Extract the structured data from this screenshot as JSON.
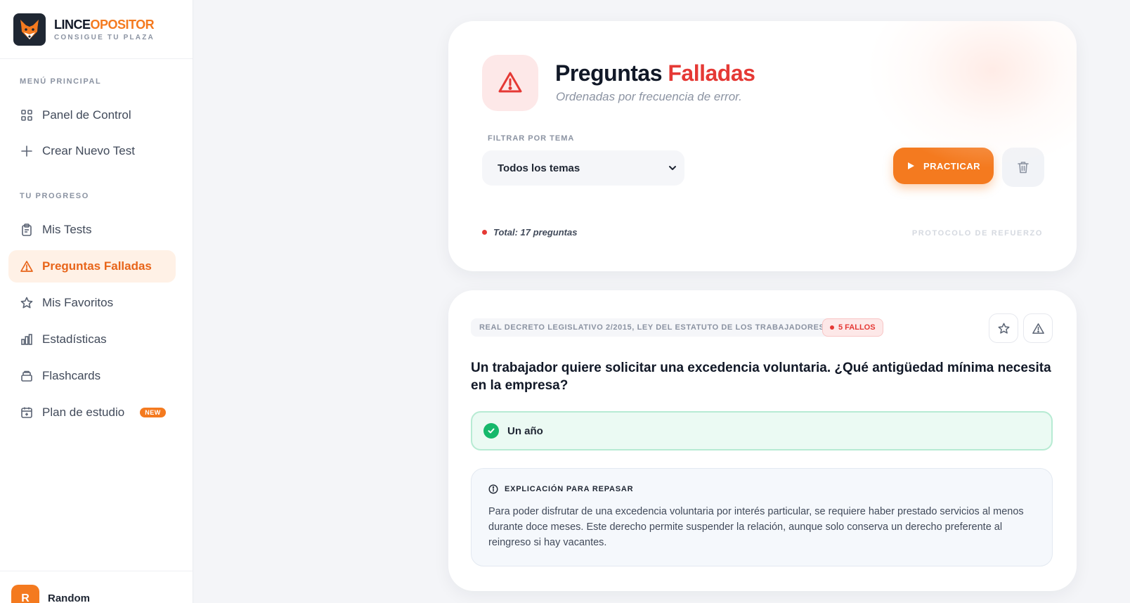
{
  "brand": {
    "name_part1": "LINCE",
    "name_part2": "OPOSITOR",
    "tagline": "CONSIGUE TU PLAZA"
  },
  "sidebar": {
    "main_section_label": "MENÚ PRINCIPAL",
    "progress_section_label": "TU PROGRESO",
    "main_items": [
      {
        "label": "Panel de Control",
        "icon": "grid-icon"
      },
      {
        "label": "Crear Nuevo Test",
        "icon": "plus-icon"
      }
    ],
    "progress_items": [
      {
        "label": "Mis Tests",
        "icon": "clipboard-icon"
      },
      {
        "label": "Preguntas Falladas",
        "icon": "alert-triangle-icon",
        "active": true
      },
      {
        "label": "Mis Favoritos",
        "icon": "star-icon"
      },
      {
        "label": "Estadísticas",
        "icon": "bar-chart-icon"
      },
      {
        "label": "Flashcards",
        "icon": "cards-icon"
      },
      {
        "label": "Plan de estudio",
        "icon": "calendar-icon",
        "badge": "NEW"
      }
    ],
    "user": {
      "initial": "R",
      "name": "Random"
    }
  },
  "header": {
    "title_part1": "Preguntas",
    "title_part2": "Falladas",
    "subtitle": "Ordenadas por frecuencia de error.",
    "filter_label": "FILTRAR POR TEMA",
    "filter_selected": "Todos los temas",
    "practice_label": "PRACTICAR",
    "total_text": "Total: 17 preguntas",
    "protocol_text": "PROTOCOLO DE REFUERZO"
  },
  "question": {
    "law_tag": "REAL DECRETO LEGISLATIVO 2/2015, LEY DEL ESTATUTO DE LOS TRABAJADORES",
    "fails_tag": "5 FALLOS",
    "text": "Un trabajador quiere solicitar una excedencia voluntaria. ¿Qué antigüedad mínima necesita en la empresa?",
    "correct_answer": "Un año",
    "explanation_label": "EXPLICACIÓN PARA REPASAR",
    "explanation_text": "Para poder disfrutar de una excedencia voluntaria por interés particular, se requiere haber prestado servicios al menos durante doce meses. Este derecho permite suspender la relación, aunque solo conserva un derecho preferente al reingreso si hay vacantes."
  },
  "colors": {
    "accent": "#f47a1f",
    "danger": "#e53935",
    "success": "#16b86b"
  }
}
